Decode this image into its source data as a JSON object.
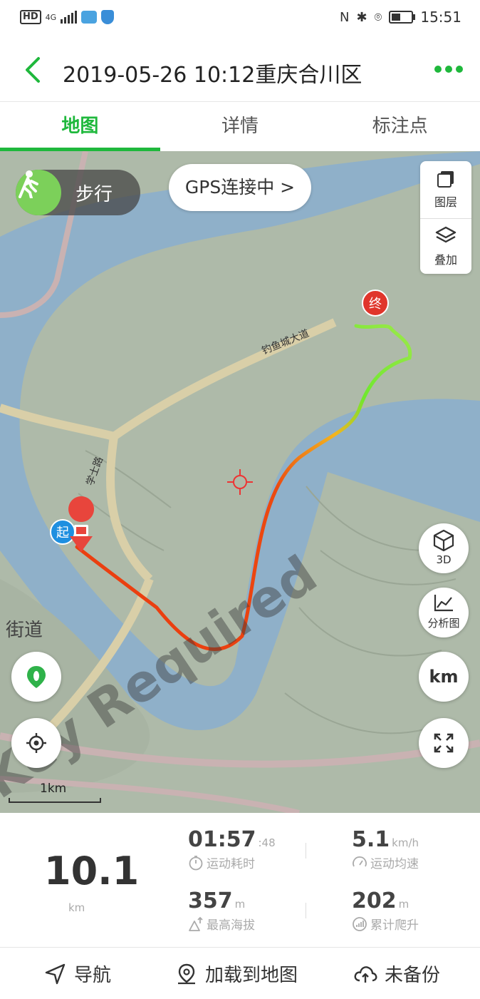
{
  "status_bar": {
    "hd": "HD",
    "network": "4G",
    "time": "15:51"
  },
  "header": {
    "title": "2019-05-26 10:12重庆合川区",
    "back_icon": "chevron-left-icon",
    "more_icon": "more-dots-icon"
  },
  "tabs": [
    {
      "label": "地图",
      "active": true
    },
    {
      "label": "详情",
      "active": false
    },
    {
      "label": "标注点",
      "active": false
    }
  ],
  "map": {
    "mode_label": "步行",
    "gps_label": "GPS连接中 >",
    "layers_label": "图层",
    "overlay_label": "叠加",
    "btn_3d": "3D",
    "btn_analysis": "分析图",
    "btn_km": "km",
    "scale_label": "1km",
    "start_marker": "起",
    "end_marker": "终",
    "road_label_1": "钓鱼城大道",
    "road_label_2": "学士路",
    "district_label": "街道",
    "watermark": "Key Required",
    "colors": {
      "water": "#8fb0c9",
      "land": "#aebaa9",
      "road": "#d9cfa8",
      "track_start": "#ea3a10",
      "track_end": "#6fe82e",
      "accent": "#1fb83c"
    }
  },
  "stats": {
    "distance": "10.1",
    "distance_unit": "km",
    "duration_main": "01:57",
    "duration_sec": ":48",
    "duration_label": "运动耗时",
    "speed": "5.1",
    "speed_unit": "km/h",
    "speed_label": "运动均速",
    "max_alt": "357",
    "max_alt_unit": "m",
    "max_alt_label": "最高海拔",
    "climb": "202",
    "climb_unit": "m",
    "climb_label": "累计爬升"
  },
  "bottom_bar": {
    "navigate": "导航",
    "load_to_map": "加载到地图",
    "backup": "未备份"
  }
}
